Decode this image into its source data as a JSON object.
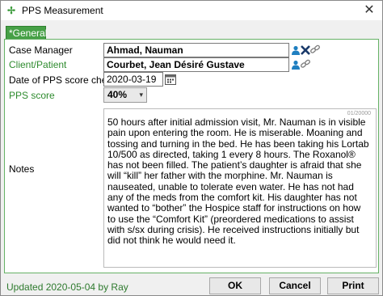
{
  "window": {
    "title": "PPS Measurement",
    "close_glyph": "✕"
  },
  "tabs": [
    {
      "label": "*General",
      "active": true
    }
  ],
  "form": {
    "case_manager": {
      "label": "Case Manager",
      "value": "Ahmad, Nauman"
    },
    "client_patient": {
      "label": "Client/Patient",
      "value": "Courbet, Jean Désiré Gustave"
    },
    "date_check": {
      "label": "Date of PPS score check",
      "value": "2020-03-19"
    },
    "pps_score": {
      "label": "PPS score",
      "value": "40%"
    },
    "notes": {
      "label": "Notes",
      "counter": "01/20000",
      "text": "50 hours after initial admission visit, Mr. Nauman is in visible pain upon entering the room. He is miserable. Moaning and tossing and turning in the bed. He has been taking his Lortab 10/500 as directed, taking 1 every 8 hours. The Roxanol® has not been filled. The patient’s daughter is afraid that she will “kill” her father with the morphine. Mr. Nauman is nauseated, unable to tolerate even water. He has not had any of the meds from the comfort kit. His daughter has not wanted to “bother” the Hospice staff for instructions on how to use the “Comfort Kit” (preordered medications to assist with s/sx during crisis). He received instructions initially but did not think he would need it."
    }
  },
  "footer": {
    "updated_text": "Updated 2020-05-04 by Ray",
    "ok_label": "OK",
    "cancel_label": "Cancel",
    "print_label": "Print"
  },
  "colors": {
    "accent_green": "#46a046",
    "label_green": "#2e8b2e",
    "icon_blue": "#1f7fc0"
  }
}
